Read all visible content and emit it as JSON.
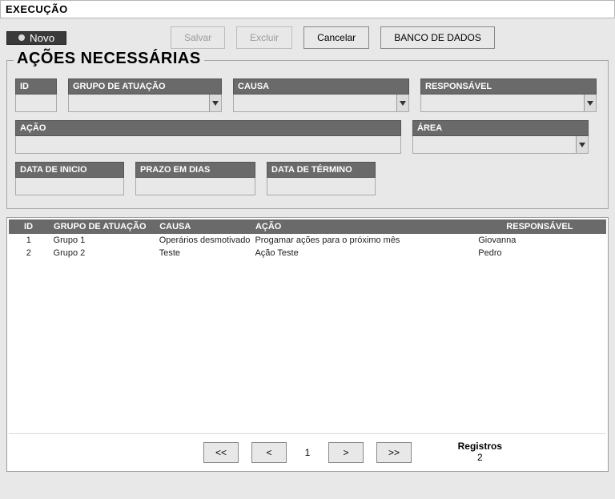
{
  "title": "EXECUÇÃO",
  "toolbar": {
    "novo": "Novo",
    "salvar": "Salvar",
    "excluir": "Excluir",
    "cancelar": "Cancelar",
    "banco_dados": "BANCO DE DADOS"
  },
  "section_title": "AÇÕES NECESSÁRIAS",
  "labels": {
    "id": "ID",
    "grupo_atuacao": "GRUPO DE ATUAÇÃO",
    "causa": "CAUSA",
    "responsavel": "RESPONSÁVEL",
    "acao": "AÇÃO",
    "area": "ÁREA",
    "data_inicio": "DATA DE INICIO",
    "prazo_dias": "PRAZO EM DIAS",
    "data_termino": "DATA DE TÉRMINO"
  },
  "fields": {
    "id": "",
    "grupo_atuacao": "",
    "causa": "",
    "responsavel": "",
    "acao": "",
    "area": "",
    "data_inicio": "",
    "prazo_dias": "",
    "data_termino": ""
  },
  "grid": {
    "headers": {
      "id": "ID",
      "grupo": "GRUPO DE ATUAÇÃO",
      "causa": "CAUSA",
      "acao": "AÇÃO",
      "responsavel": "RESPONSÁVEL"
    },
    "rows": [
      {
        "id": "1",
        "grupo": "Grupo 1",
        "causa": "Operários desmotivado",
        "acao": "Progamar ações para o próximo mês",
        "responsavel": "Giovanna"
      },
      {
        "id": "2",
        "grupo": "Grupo 2",
        "causa": "Teste",
        "acao": "Ação Teste",
        "responsavel": "Pedro"
      }
    ]
  },
  "pager": {
    "first": "<<",
    "prev": "<",
    "page": "1",
    "next": ">",
    "last": ">>",
    "records_label": "Registros",
    "records_count": "2"
  }
}
